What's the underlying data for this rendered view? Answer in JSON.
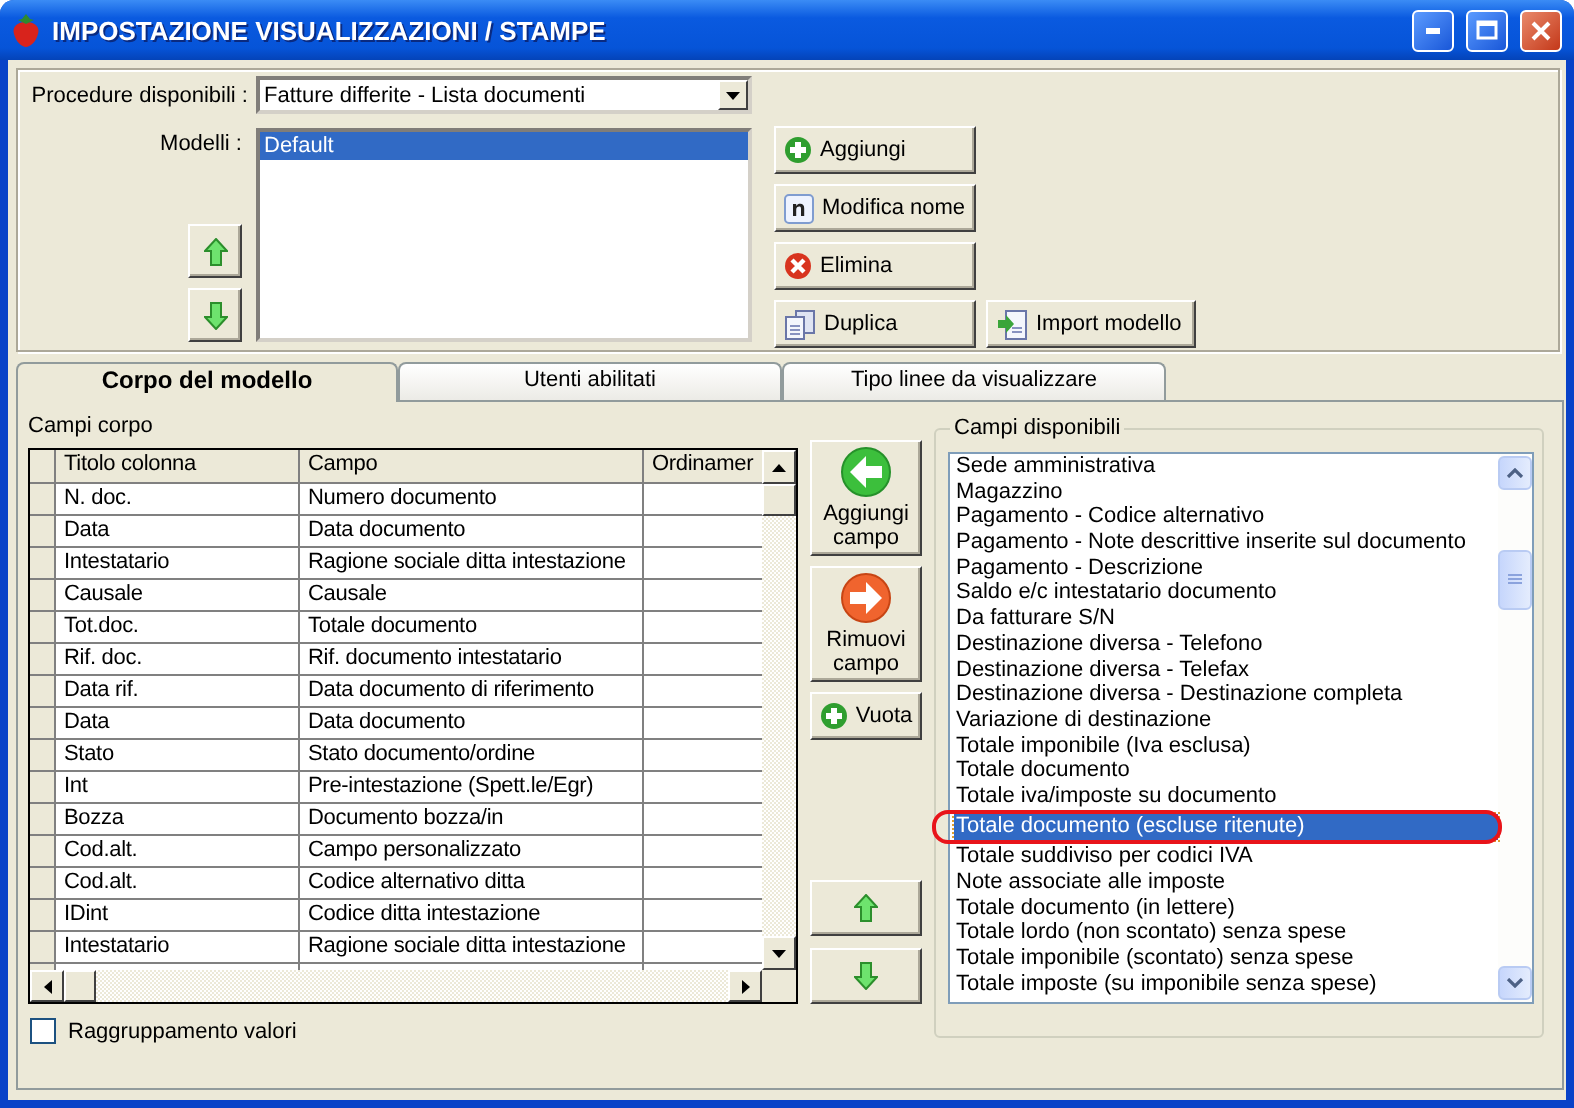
{
  "window": {
    "title": "IMPOSTAZIONE VISUALIZZAZIONI / STAMPE"
  },
  "procedure": {
    "label": "Procedure disponibili :",
    "value": "Fatture differite - Lista documenti"
  },
  "models": {
    "label": "Modelli :",
    "items": [
      {
        "label": "Default",
        "selected": true
      }
    ]
  },
  "model_buttons": [
    {
      "label": "Aggiungi",
      "kind": "add"
    },
    {
      "label": "Modifica nome",
      "kind": "rename"
    },
    {
      "label": "Elimina",
      "kind": "delete"
    },
    {
      "label": "Duplica",
      "kind": "duplicate"
    },
    {
      "label": "Import modello",
      "kind": "import"
    }
  ],
  "tabs": [
    {
      "label": "Corpo del modello",
      "selected": true
    },
    {
      "label": "Utenti abilitati",
      "selected": false
    },
    {
      "label": "Tipo linee da visualizzare",
      "selected": false
    }
  ],
  "body_fields": {
    "title": "Campi corpo",
    "columns": [
      "Titolo colonna",
      "Campo",
      "Ordinamer"
    ],
    "rows": [
      {
        "title": "N. doc.",
        "field": "Numero documento"
      },
      {
        "title": "Data",
        "field": "Data documento"
      },
      {
        "title": "Intestatario",
        "field": "Ragione sociale ditta intestazione"
      },
      {
        "title": "Causale",
        "field": "Causale"
      },
      {
        "title": "Tot.doc.",
        "field": "Totale documento"
      },
      {
        "title": "Rif. doc.",
        "field": "Rif. documento intestatario"
      },
      {
        "title": "Data rif.",
        "field": "Data documento di riferimento"
      },
      {
        "title": "Data",
        "field": "Data documento"
      },
      {
        "title": "Stato",
        "field": "Stato documento/ordine"
      },
      {
        "title": "Int",
        "field": "Pre-intestazione (Spett.le/Egr)"
      },
      {
        "title": "Bozza",
        "field": "Documento bozza/in"
      },
      {
        "title": "Cod.alt.",
        "field": "Campo personalizzato"
      },
      {
        "title": "Cod.alt.",
        "field": "Codice alternativo ditta"
      },
      {
        "title": "IDint",
        "field": "Codice ditta intestazione"
      },
      {
        "title": "Intestatario",
        "field": "Ragione sociale ditta intestazione"
      }
    ]
  },
  "field_buttons": [
    {
      "label": "Aggiungi campo",
      "kind": "add"
    },
    {
      "label": "Rimuovi campo",
      "kind": "remove"
    },
    {
      "label": "Vuota",
      "kind": "clear"
    }
  ],
  "grouping": {
    "label": "Raggruppamento valori",
    "checked": false
  },
  "available": {
    "title": "Campi disponibili",
    "items": [
      {
        "label": "Sede amministrativa",
        "selected": false,
        "circled": false
      },
      {
        "label": "Magazzino",
        "selected": false,
        "circled": false
      },
      {
        "label": "Pagamento - Codice alternativo",
        "selected": false,
        "circled": false
      },
      {
        "label": "Pagamento - Note descrittive inserite sul documento",
        "selected": false,
        "circled": false
      },
      {
        "label": "Pagamento - Descrizione",
        "selected": false,
        "circled": false
      },
      {
        "label": "Saldo e/c intestatario documento",
        "selected": false,
        "circled": false
      },
      {
        "label": "Da fatturare S/N",
        "selected": false,
        "circled": false
      },
      {
        "label": "Destinazione diversa - Telefono",
        "selected": false,
        "circled": false
      },
      {
        "label": "Destinazione diversa - Telefax",
        "selected": false,
        "circled": false
      },
      {
        "label": "Destinazione diversa - Destinazione completa",
        "selected": false,
        "circled": false
      },
      {
        "label": "Variazione di destinazione",
        "selected": false,
        "circled": false
      },
      {
        "label": "Totale imponibile (Iva esclusa)",
        "selected": false,
        "circled": false
      },
      {
        "label": "Totale documento",
        "selected": false,
        "circled": false
      },
      {
        "label": "Totale iva/imposte su documento",
        "selected": false,
        "circled": false
      },
      {
        "label": "Totale documento (escluse ritenute)",
        "selected": true,
        "circled": true
      },
      {
        "label": "Totale suddiviso per codici IVA",
        "selected": false,
        "circled": false
      },
      {
        "label": "Note associate alle imposte",
        "selected": false,
        "circled": false
      },
      {
        "label": "Totale documento (in lettere)",
        "selected": false,
        "circled": false
      },
      {
        "label": "Totale lordo (non scontato) senza spese",
        "selected": false,
        "circled": false
      },
      {
        "label": "Totale imponibile (scontato) senza spese",
        "selected": false,
        "circled": false
      },
      {
        "label": "Totale imposte (su imponibile senza spese)",
        "selected": false,
        "circled": false
      }
    ]
  }
}
